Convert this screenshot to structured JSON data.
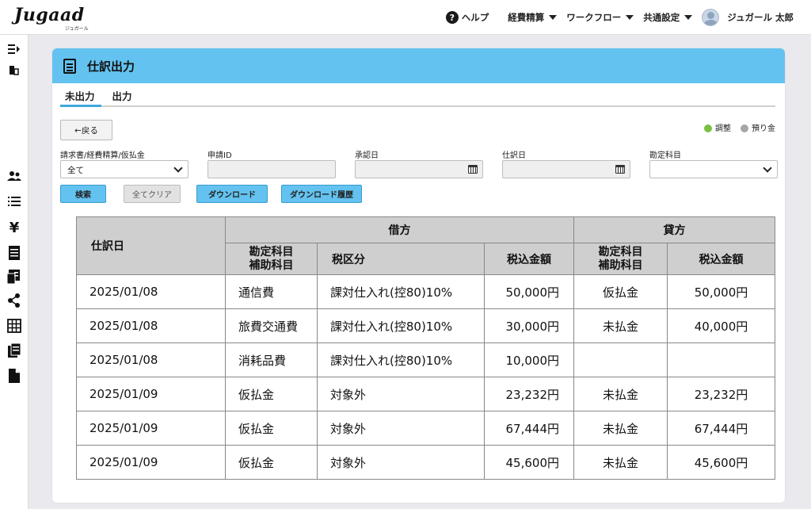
{
  "header": {
    "logo": "Jugaad",
    "logo_sub": "ジュガール",
    "nav": {
      "help": "ヘルプ",
      "expense": "経費精算",
      "workflow": "ワークフロー",
      "common": "共通設定",
      "user": "ジュガール 太郎"
    }
  },
  "page": {
    "title": "仕訳出力",
    "tabs": [
      "未出力",
      "出力"
    ],
    "back": "←戻る",
    "legend": [
      {
        "label": "調整",
        "color": "#7ac143"
      },
      {
        "label": "預り金",
        "color": "#a6a6a6"
      }
    ]
  },
  "filters": {
    "type_label": "請求書/経費精算/仮払金",
    "type_value": "全て",
    "app_id_label": "申請ID",
    "approve_label": "承認日",
    "journal_date_label": "仕訳日",
    "account_label": "勘定科目"
  },
  "buttons": {
    "search": "検索",
    "clear": "全てクリア",
    "download": "ダウンロード",
    "history": "ダウンロード履歴"
  },
  "table": {
    "headers": {
      "date": "仕訳日",
      "debit": "借方",
      "credit": "貸方",
      "account1": "勘定科目",
      "account2": "補助科目",
      "tax_cat": "税区分",
      "amount": "税込金額"
    },
    "rows": [
      {
        "date": "2025/01/08",
        "d_account": "通信費",
        "tax": "課対仕入れ(控80)10%",
        "d_amount": "50,000円",
        "c_account": "仮払金",
        "c_amount": "50,000円"
      },
      {
        "date": "2025/01/08",
        "d_account": "旅費交通費",
        "tax": "課対仕入れ(控80)10%",
        "d_amount": "30,000円",
        "c_account": "未払金",
        "c_amount": "40,000円"
      },
      {
        "date": "2025/01/08",
        "d_account": "消耗品費",
        "tax": "課対仕入れ(控80)10%",
        "d_amount": "10,000円",
        "c_account": "",
        "c_amount": ""
      },
      {
        "date": "2025/01/09",
        "d_account": "仮払金",
        "tax": "対象外",
        "d_amount": "23,232円",
        "c_account": "未払金",
        "c_amount": "23,232円"
      },
      {
        "date": "2025/01/09",
        "d_account": "仮払金",
        "tax": "対象外",
        "d_amount": "67,444円",
        "c_account": "未払金",
        "c_amount": "67,444円"
      },
      {
        "date": "2025/01/09",
        "d_account": "仮払金",
        "tax": "対象外",
        "d_amount": "45,600円",
        "c_account": "未払金",
        "c_amount": "45,600円"
      }
    ]
  }
}
